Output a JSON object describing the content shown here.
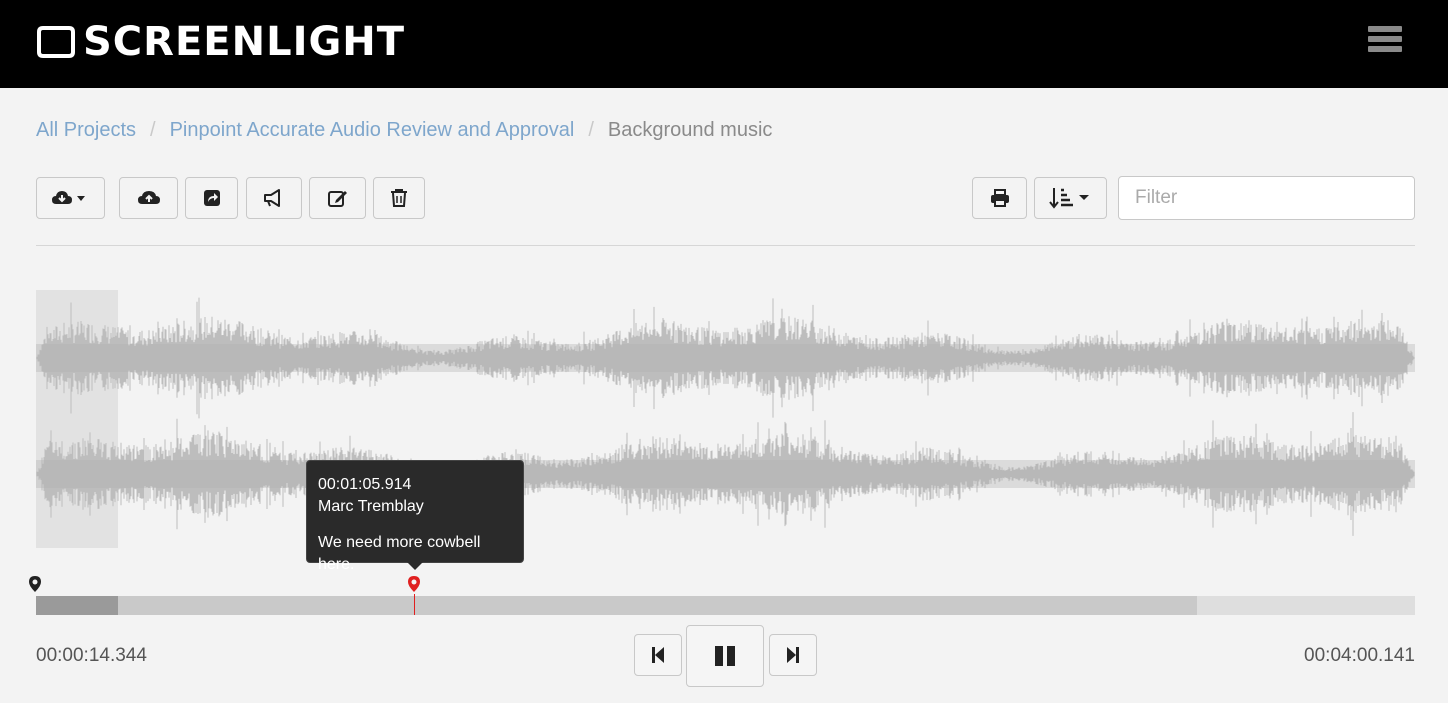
{
  "app": {
    "brand": "SCREENLIGHT",
    "menu_icon": "hamburger-icon"
  },
  "breadcrumb": {
    "items": [
      {
        "label": "All Projects"
      },
      {
        "label": "Pinpoint Accurate Audio Review and Approval"
      }
    ],
    "current": "Background music",
    "separator": "/"
  },
  "toolbar": {
    "left_buttons": [
      {
        "icon": "cloud-download-dropdown-icon"
      },
      {
        "icon": "cloud-upload-icon"
      },
      {
        "icon": "share-icon"
      },
      {
        "icon": "megaphone-icon"
      },
      {
        "icon": "edit-icon"
      },
      {
        "icon": "trash-icon"
      }
    ],
    "right_buttons": [
      {
        "icon": "print-icon"
      },
      {
        "icon": "sort-dropdown-icon"
      }
    ],
    "filter": {
      "placeholder": "Filter",
      "value": ""
    }
  },
  "player": {
    "current_time": "00:00:14.344",
    "total_time": "00:04:00.141",
    "played_fraction": 0.0597,
    "buffered_fraction": 0.842,
    "state": "playing",
    "controls": [
      {
        "icon": "skip-previous-icon"
      },
      {
        "icon": "pause-icon"
      },
      {
        "icon": "skip-next-icon"
      }
    ]
  },
  "comment": {
    "timestamp": "00:01:05.914",
    "author": "Marc Tremblay",
    "text": "We need more cowbell here.",
    "position_fraction": 0.2745,
    "marker_color": "#e02020"
  },
  "colors": {
    "topbar": "#000000",
    "link": "#7ea6cc",
    "waveform": "#bdbdbd",
    "tooltip_bg": "#2a2a2a"
  }
}
